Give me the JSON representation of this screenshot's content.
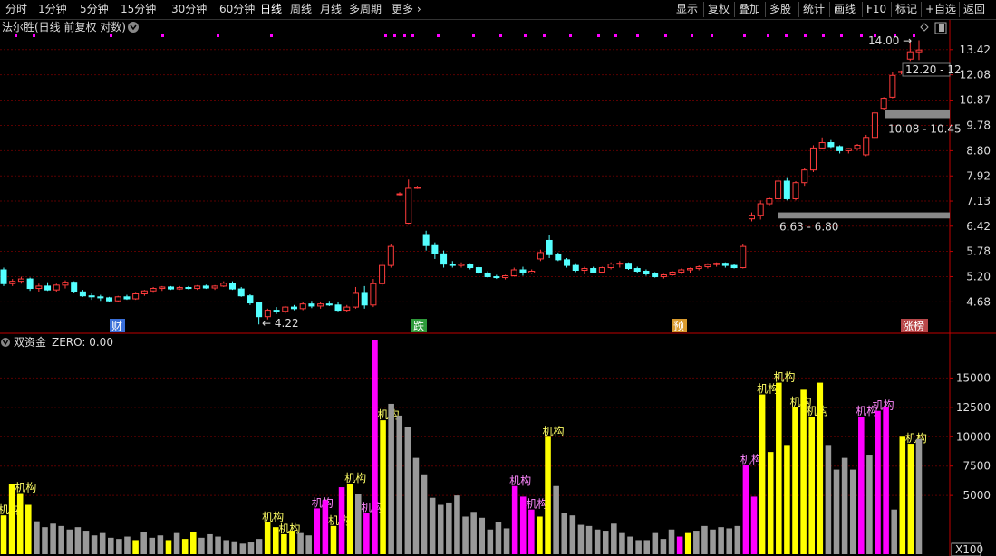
{
  "toolbar": {
    "left": [
      "分时",
      "1分钟",
      "5分钟",
      "15分钟",
      "30分钟",
      "60分钟",
      "日线",
      "周线",
      "月线",
      "多周期",
      "更多"
    ],
    "active": "日线",
    "right": [
      "显示",
      "复权",
      "叠加",
      "多股",
      "统计",
      "画线",
      "F10",
      "标记",
      "+自选",
      "返回"
    ]
  },
  "main_chart": {
    "title": "法尔胜(日线 前复权 对数)",
    "price_ticks": [
      "13.42",
      "12.08",
      "10.87",
      "9.78",
      "8.80",
      "7.92",
      "7.13",
      "6.42",
      "5.78",
      "5.20",
      "4.68"
    ],
    "annotations": {
      "low_label": "4.22",
      "high_label": "14.00",
      "gap_boxes": [
        "12.20 - 12",
        "10.08 - 10.45",
        "6.63 - 6.80"
      ]
    },
    "event_tags": [
      {
        "text": "财",
        "color": "#3a6fd8"
      },
      {
        "text": "跌",
        "color": "#2e9a3a"
      },
      {
        "text": "预",
        "color": "#d89a2e"
      },
      {
        "text": "涨榜",
        "color": "#b9484a"
      }
    ],
    "colors": {
      "up": "#ff3c3c",
      "down": "#54ffff",
      "marker": "#ff00ff",
      "grid": "#5a0000",
      "axis": "#c00000"
    }
  },
  "sub_chart": {
    "title": "双资金",
    "zero_label": "ZERO: 0.00",
    "y_ticks": [
      "15000",
      "12500",
      "10000",
      "7500",
      "5000"
    ],
    "scale_label": "X100",
    "bar_label": "机构",
    "peak_label": "机构"
  },
  "chart_data": [
    {
      "type": "candlestick",
      "title": "法尔胜(日线 前复权 对数)",
      "y_scale": "log",
      "ylim": [
        4.2,
        14.3
      ],
      "candles_ohlc": [
        [
          5.35,
          5.4,
          5.0,
          5.05
        ],
        [
          5.05,
          5.15,
          5.0,
          5.1
        ],
        [
          5.1,
          5.2,
          5.05,
          5.15
        ],
        [
          5.15,
          5.18,
          4.9,
          4.95
        ],
        [
          4.95,
          5.05,
          4.88,
          5.0
        ],
        [
          5.0,
          5.08,
          4.9,
          4.92
        ],
        [
          4.92,
          5.05,
          4.88,
          5.02
        ],
        [
          5.02,
          5.12,
          4.95,
          5.08
        ],
        [
          5.08,
          5.1,
          4.85,
          4.88
        ],
        [
          4.88,
          4.92,
          4.78,
          4.8
        ],
        [
          4.8,
          4.85,
          4.72,
          4.78
        ],
        [
          4.78,
          4.82,
          4.7,
          4.76
        ],
        [
          4.76,
          4.78,
          4.68,
          4.7
        ],
        [
          4.7,
          4.8,
          4.68,
          4.78
        ],
        [
          4.78,
          4.82,
          4.72,
          4.74
        ],
        [
          4.74,
          4.86,
          4.72,
          4.84
        ],
        [
          4.84,
          4.92,
          4.8,
          4.9
        ],
        [
          4.9,
          4.98,
          4.86,
          4.95
        ],
        [
          4.95,
          5.0,
          4.9,
          4.98
        ],
        [
          4.98,
          5.0,
          4.92,
          4.94
        ],
        [
          4.94,
          5.0,
          4.92,
          4.97
        ],
        [
          4.97,
          5.0,
          4.93,
          4.95
        ],
        [
          4.95,
          5.02,
          4.92,
          5.0
        ],
        [
          5.0,
          5.03,
          4.94,
          4.96
        ],
        [
          4.96,
          5.02,
          4.92,
          5.0
        ],
        [
          5.0,
          5.1,
          4.98,
          5.06
        ],
        [
          5.06,
          5.1,
          4.92,
          4.94
        ],
        [
          4.94,
          4.98,
          4.78,
          4.8
        ],
        [
          4.8,
          4.83,
          4.62,
          4.66
        ],
        [
          4.66,
          4.68,
          4.26,
          4.4
        ],
        [
          4.4,
          4.55,
          4.35,
          4.52
        ],
        [
          4.52,
          4.58,
          4.45,
          4.5
        ],
        [
          4.5,
          4.6,
          4.46,
          4.58
        ],
        [
          4.58,
          4.62,
          4.52,
          4.55
        ],
        [
          4.55,
          4.68,
          4.52,
          4.64
        ],
        [
          4.64,
          4.7,
          4.56,
          4.6
        ],
        [
          4.6,
          4.68,
          4.55,
          4.64
        ],
        [
          4.64,
          4.7,
          4.6,
          4.62
        ],
        [
          4.62,
          4.68,
          4.5,
          4.52
        ],
        [
          4.52,
          4.62,
          4.48,
          4.58
        ],
        [
          4.58,
          4.98,
          4.55,
          4.85
        ],
        [
          4.85,
          5.0,
          4.55,
          4.62
        ],
        [
          4.62,
          5.15,
          4.58,
          5.05
        ],
        [
          5.05,
          5.55,
          5.0,
          5.45
        ],
        [
          5.45,
          5.95,
          5.4,
          5.9
        ],
        [
          7.35,
          7.4,
          7.3,
          7.35
        ],
        [
          6.5,
          7.8,
          6.48,
          7.52
        ],
        [
          7.52,
          7.6,
          7.5,
          7.55
        ],
        [
          6.2,
          6.3,
          5.8,
          5.92
        ],
        [
          5.92,
          6.0,
          5.6,
          5.72
        ],
        [
          5.72,
          5.8,
          5.4,
          5.48
        ],
        [
          5.48,
          5.55,
          5.4,
          5.45
        ],
        [
          5.45,
          5.52,
          5.4,
          5.48
        ],
        [
          5.48,
          5.5,
          5.36,
          5.4
        ],
        [
          5.4,
          5.44,
          5.25,
          5.28
        ],
        [
          5.28,
          5.32,
          5.18,
          5.2
        ],
        [
          5.2,
          5.24,
          5.15,
          5.18
        ],
        [
          5.18,
          5.24,
          5.14,
          5.22
        ],
        [
          5.22,
          5.4,
          5.2,
          5.35
        ],
        [
          5.35,
          5.42,
          5.22,
          5.28
        ],
        [
          5.28,
          5.36,
          5.26,
          5.32
        ],
        [
          5.6,
          5.82,
          5.55,
          5.75
        ],
        [
          6.05,
          6.2,
          5.62,
          5.7
        ],
        [
          5.7,
          5.75,
          5.55,
          5.58
        ],
        [
          5.58,
          5.62,
          5.4,
          5.45
        ],
        [
          5.45,
          5.5,
          5.3,
          5.34
        ],
        [
          5.34,
          5.42,
          5.25,
          5.38
        ],
        [
          5.38,
          5.42,
          5.28,
          5.3
        ],
        [
          5.3,
          5.42,
          5.28,
          5.4
        ],
        [
          5.4,
          5.52,
          5.36,
          5.48
        ],
        [
          5.48,
          5.55,
          5.4,
          5.5
        ],
        [
          5.5,
          5.52,
          5.35,
          5.38
        ],
        [
          5.38,
          5.42,
          5.28,
          5.32
        ],
        [
          5.32,
          5.36,
          5.22,
          5.26
        ],
        [
          5.26,
          5.3,
          5.18,
          5.2
        ],
        [
          5.2,
          5.26,
          5.16,
          5.24
        ],
        [
          5.24,
          5.32,
          5.22,
          5.3
        ],
        [
          5.3,
          5.38,
          5.26,
          5.35
        ],
        [
          5.35,
          5.4,
          5.28,
          5.38
        ],
        [
          5.38,
          5.45,
          5.34,
          5.42
        ],
        [
          5.42,
          5.5,
          5.38,
          5.47
        ],
        [
          5.47,
          5.52,
          5.42,
          5.5
        ],
        [
          5.5,
          5.52,
          5.4,
          5.45
        ],
        [
          5.45,
          5.48,
          5.38,
          5.4
        ],
        [
          5.4,
          5.95,
          5.38,
          5.9
        ],
        [
          6.62,
          6.8,
          6.55,
          6.72
        ],
        [
          6.72,
          7.15,
          6.6,
          7.05
        ],
        [
          7.05,
          7.25,
          7.0,
          7.2
        ],
        [
          7.2,
          7.9,
          7.1,
          7.75
        ],
        [
          7.75,
          7.85,
          7.15,
          7.2
        ],
        [
          7.2,
          7.75,
          7.15,
          7.7
        ],
        [
          7.7,
          8.2,
          7.6,
          8.12
        ],
        [
          8.12,
          9.0,
          8.05,
          8.9
        ],
        [
          8.9,
          9.3,
          8.85,
          9.1
        ],
        [
          9.1,
          9.2,
          8.9,
          8.95
        ],
        [
          8.95,
          9.0,
          8.7,
          8.8
        ],
        [
          8.8,
          8.9,
          8.7,
          8.88
        ],
        [
          8.88,
          9.05,
          8.8,
          9.0
        ],
        [
          8.65,
          9.4,
          8.6,
          9.3
        ],
        [
          9.3,
          10.45,
          9.25,
          10.3
        ],
        [
          10.5,
          11.0,
          10.45,
          10.95
        ],
        [
          11.0,
          12.2,
          10.95,
          12.05
        ],
        [
          12.2,
          12.3,
          12.1,
          12.25
        ],
        [
          12.9,
          14.0,
          12.8,
          13.3
        ],
        [
          13.3,
          13.95,
          12.85,
          13.4
        ]
      ]
    },
    {
      "type": "bar",
      "title": "双资金",
      "y_ticks": [
        15000,
        12500,
        10000,
        7500,
        5000
      ],
      "values": [
        3300,
        6000,
        5200,
        4200,
        2800,
        2300,
        2600,
        2400,
        2100,
        2300,
        2000,
        1600,
        1800,
        1400,
        1300,
        1500,
        1200,
        1900,
        1400,
        1600,
        1200,
        1800,
        1300,
        1900,
        1400,
        1700,
        1500,
        1200,
        1100,
        900,
        1000,
        1300,
        2700,
        2300,
        1700,
        2000,
        1800,
        1600,
        3900,
        4600,
        2400,
        5700,
        6000,
        5100,
        3500,
        18200,
        11400,
        12800,
        11800,
        10800,
        8200,
        6800,
        4800,
        4200,
        4400,
        5000,
        3200,
        3600,
        3100,
        2100,
        2700,
        2200,
        5800,
        4900,
        3800,
        3200,
        10000,
        5800,
        3500,
        3300,
        2500,
        2400,
        2100,
        2000,
        2600,
        1800,
        1500,
        1200,
        1200,
        1800,
        1300,
        2100,
        1500,
        1800,
        2000,
        2400,
        2100,
        2300,
        2200,
        2400,
        7600,
        4900,
        13600,
        8700,
        14600,
        9300,
        12500,
        14000,
        11700,
        14600,
        9300,
        7200,
        8200,
        7200,
        11700,
        8400,
        12200,
        12500,
        3800,
        10000,
        9400,
        9800
      ],
      "bar_colors": [
        "y",
        "y",
        "y",
        "y",
        "g",
        "g",
        "g",
        "g",
        "g",
        "g",
        "g",
        "g",
        "g",
        "g",
        "g",
        "g",
        "y",
        "g",
        "g",
        "g",
        "y",
        "g",
        "y",
        "y",
        "g",
        "g",
        "g",
        "g",
        "g",
        "g",
        "g",
        "g",
        "y",
        "y",
        "y",
        "y",
        "g",
        "g",
        "m",
        "m",
        "y",
        "m",
        "y",
        "g",
        "m",
        "m",
        "y",
        "g",
        "g",
        "g",
        "g",
        "g",
        "g",
        "g",
        "g",
        "g",
        "g",
        "g",
        "g",
        "g",
        "g",
        "g",
        "m",
        "m",
        "m",
        "y",
        "y",
        "g",
        "g",
        "g",
        "g",
        "g",
        "g",
        "g",
        "g",
        "g",
        "g",
        "g",
        "g",
        "g",
        "g",
        "g",
        "m",
        "y",
        "g",
        "g",
        "g",
        "g",
        "g",
        "g",
        "m",
        "m",
        "y",
        "y",
        "y",
        "y",
        "y",
        "y",
        "y",
        "y",
        "g",
        "g",
        "g",
        "g",
        "m",
        "g",
        "m",
        "m",
        "g",
        "y",
        "y",
        "g"
      ]
    }
  ]
}
